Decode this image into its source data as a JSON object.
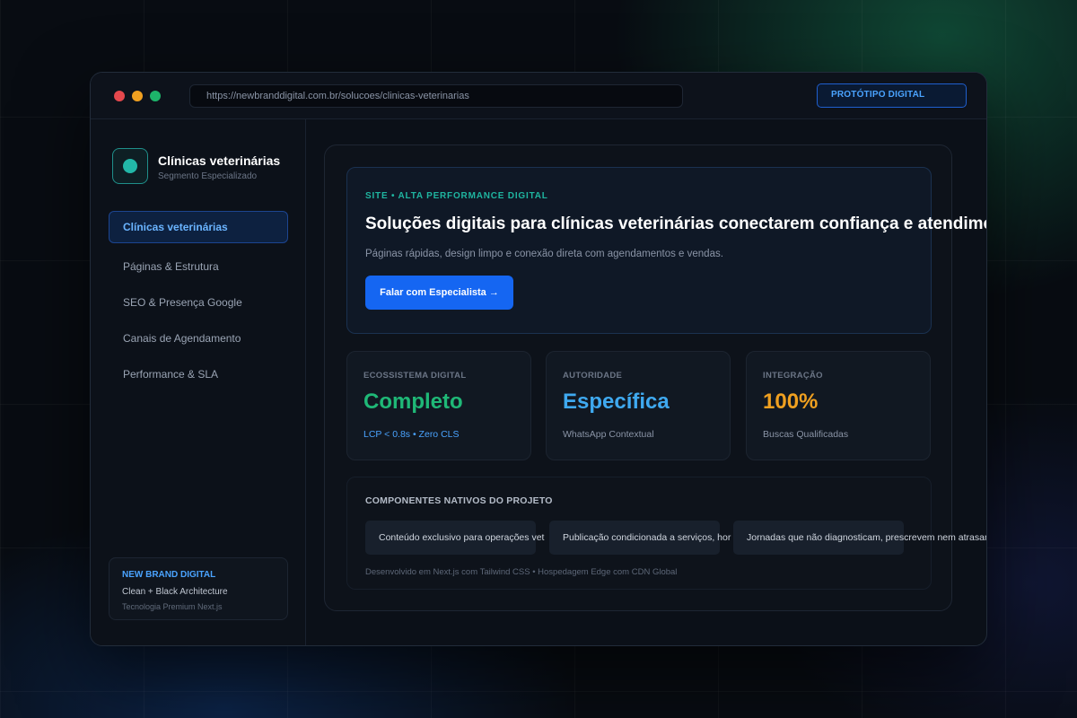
{
  "browser": {
    "url": "https://newbranddigital.com.br/solucoes/clinicas-veterinarias",
    "badge": "PROTÓTIPO DIGITAL"
  },
  "sidebar": {
    "brand_title": "Clínicas veterinárias",
    "brand_subtitle": "Segmento Especializado",
    "items": [
      {
        "label": "Clínicas veterinárias",
        "active": true
      },
      {
        "label": "Páginas & Estrutura",
        "active": false
      },
      {
        "label": "SEO & Presença Google",
        "active": false
      },
      {
        "label": "Canais de Agendamento",
        "active": false
      },
      {
        "label": "Performance & SLA",
        "active": false
      }
    ],
    "card": {
      "title": "NEW BRAND DIGITAL",
      "line1": "Clean + Black Architecture",
      "line2": "Tecnologia Premium Next.js"
    }
  },
  "hero": {
    "eyebrow": "SITE • ALTA PERFORMANCE DIGITAL",
    "title": "Soluções digitais para clínicas veterinárias conectarem confiança e atendimento",
    "description": "Páginas rápidas, design limpo e conexão direta com agendamentos e vendas.",
    "cta": "Falar com Especialista →"
  },
  "stats": [
    {
      "label": "ECOSSISTEMA DIGITAL",
      "value": "Completo",
      "sub": "LCP < 0.8s • Zero CLS",
      "value_color": "#1fb877",
      "sub_color": "#4aa3ff"
    },
    {
      "label": "AUTORIDADE",
      "value": "Específica",
      "sub": "WhatsApp Contextual",
      "value_color": "#3fa9f0",
      "sub_color": "#8a94a6"
    },
    {
      "label": "INTEGRAÇÃO",
      "value": "100%",
      "sub": "Buscas Qualificadas",
      "value_color": "#f0a020",
      "sub_color": "#8a94a6"
    }
  ],
  "components": {
    "title": "COMPONENTES NATIVOS DO PROJETO",
    "chips": [
      "Conteúdo exclusivo para operações vet",
      "Publicação condicionada a serviços, hor",
      "Jornadas que não diagnosticam, prescrevem nem atrasam encaminhamentos"
    ],
    "footer": "Desenvolvido em Next.js com Tailwind CSS • Hospedagem Edge com CDN Global"
  }
}
